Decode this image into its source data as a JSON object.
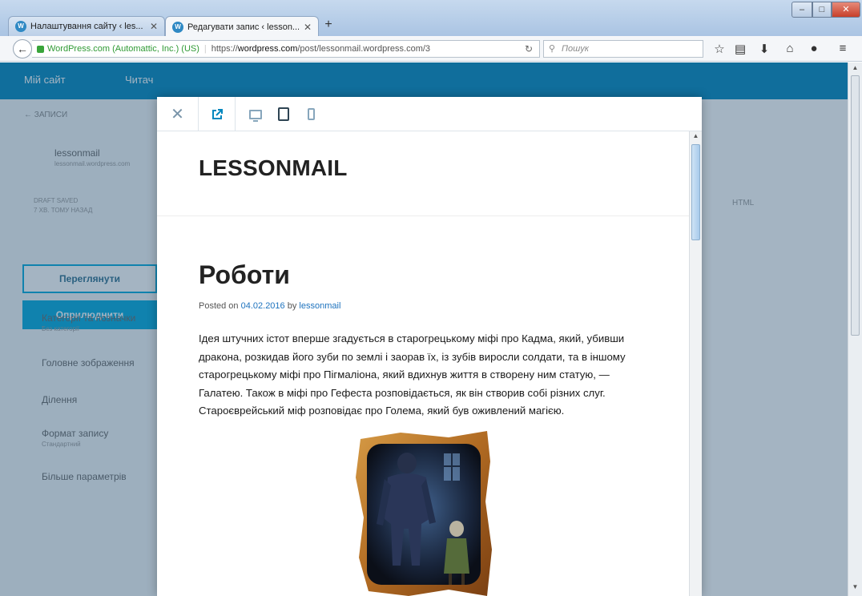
{
  "browser": {
    "tabs": [
      {
        "label": "Налаштування сайту ‹ les...",
        "active": false
      },
      {
        "label": "Редагувати запис ‹ lesson...",
        "active": true
      }
    ],
    "new_tab": "+",
    "url_cert": "WordPress.com (Automattic, Inc.) (US)",
    "url_prefix": "https://",
    "url_domain": "wordpress.com",
    "url_path": "/post/lessonmail.wordpress.com/3",
    "search_placeholder": "Пошук"
  },
  "wp": {
    "masterbar": {
      "my_site": "Мій сайт",
      "reader": "Читач"
    },
    "sidebar": {
      "back": "← ЗАПИСИ",
      "site_name": "lessonmail",
      "site_url": "lessonmail.wordpress.com",
      "draft_status": "DRAFT SAVED",
      "draft_time": "7 ХВ. ТОМУ НАЗАД",
      "preview_button": "Переглянути",
      "publish_button": "Оприлюднити",
      "items": [
        {
          "label": "Категорії та позначки",
          "sub": "Без категорії"
        },
        {
          "label": "Головне зображення"
        },
        {
          "label": "Ділення"
        },
        {
          "label": "Формат запису",
          "sub": "Стандартний"
        },
        {
          "label": "Більше параметрів"
        }
      ]
    },
    "editor_tab_html": "HTML"
  },
  "preview": {
    "site_title": "LESSONMAIL",
    "post_title": "Роботи",
    "meta_posted_on": "Posted on",
    "meta_date": "04.02.2016",
    "meta_by": "by",
    "meta_author": "lessonmail",
    "body": "Ідея штучних істот вперше згадується в старогрецькому міфі про Кадма, який, убивши дракона, розкидав його зуби по землі і заорав їх, із зубів виросли солдати, та в іншому старогрецькому міфі про Пігмаліона, який вдихнув життя в створену ним статую, — Галатею. Також в міфі про Гефеста розповідається, як він створив собі різних слуг. Староєврейський міф розповідає про Голема, який був оживлений магією."
  },
  "colors": {
    "wp_blue": "#0087be",
    "accent": "#00aadc",
    "link": "#1e73be"
  }
}
